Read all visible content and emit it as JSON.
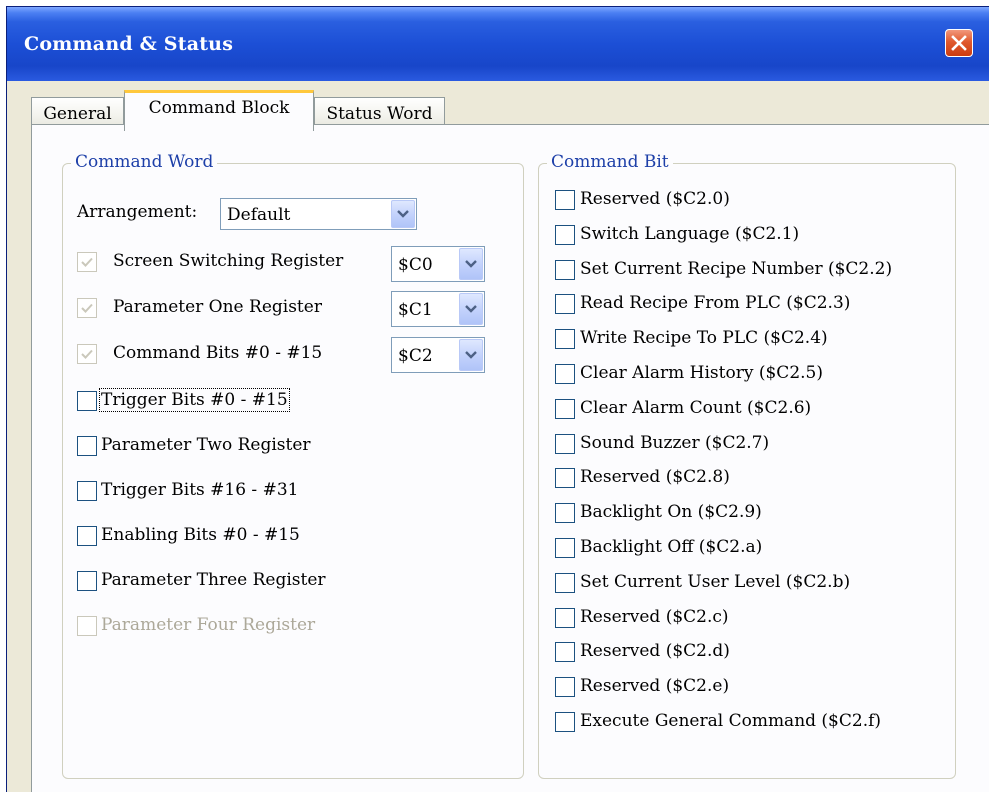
{
  "window": {
    "title": "Command & Status"
  },
  "tabs": [
    {
      "label": "General",
      "active": false
    },
    {
      "label": "Command Block",
      "active": true
    },
    {
      "label": "Status Word",
      "active": false
    }
  ],
  "command_word": {
    "legend": "Command Word",
    "arrangement_label": "Arrangement:",
    "arrangement_value": "Default",
    "registers": [
      {
        "label": "Screen Switching Register",
        "checked": true,
        "disabled": true,
        "address": "$C0"
      },
      {
        "label": "Parameter One Register",
        "checked": true,
        "disabled": true,
        "address": "$C1"
      },
      {
        "label": "Command Bits #0 - #15",
        "checked": true,
        "disabled": true,
        "address": "$C2"
      }
    ],
    "options": [
      {
        "label": "Trigger Bits #0 - #15",
        "checked": false,
        "disabled": false,
        "focused": true
      },
      {
        "label": "Parameter Two Register",
        "checked": false,
        "disabled": false
      },
      {
        "label": "Trigger Bits #16 - #31",
        "checked": false,
        "disabled": false
      },
      {
        "label": "Enabling Bits #0 - #15",
        "checked": false,
        "disabled": false
      },
      {
        "label": "Parameter Three Register",
        "checked": false,
        "disabled": false
      },
      {
        "label": "Parameter Four Register",
        "checked": false,
        "disabled": true
      }
    ]
  },
  "command_bit": {
    "legend": "Command Bit",
    "items": [
      {
        "label": "Reserved ($C2.0)",
        "checked": false
      },
      {
        "label": "Switch Language ($C2.1)",
        "checked": false
      },
      {
        "label": "Set Current Recipe Number ($C2.2)",
        "checked": false
      },
      {
        "label": "Read Recipe From PLC ($C2.3)",
        "checked": false
      },
      {
        "label": "Write Recipe To PLC ($C2.4)",
        "checked": false
      },
      {
        "label": "Clear Alarm History ($C2.5)",
        "checked": false
      },
      {
        "label": "Clear Alarm Count ($C2.6)",
        "checked": false
      },
      {
        "label": "Sound Buzzer ($C2.7)",
        "checked": false
      },
      {
        "label": "Reserved ($C2.8)",
        "checked": false
      },
      {
        "label": "Backlight On ($C2.9)",
        "checked": false
      },
      {
        "label": "Backlight Off ($C2.a)",
        "checked": false
      },
      {
        "label": "Set Current User Level ($C2.b)",
        "checked": false
      },
      {
        "label": "Reserved ($C2.c)",
        "checked": false
      },
      {
        "label": "Reserved ($C2.d)",
        "checked": false
      },
      {
        "label": "Reserved ($C2.e)",
        "checked": false
      },
      {
        "label": "Execute General Command ($C2.f)",
        "checked": false
      }
    ]
  },
  "colors": {
    "titlebar": "#1c4fd6",
    "close_button": "#e05a2e",
    "group_legend": "#1d3fa8",
    "active_tab_highlight": "#ffc83c",
    "disabled_text": "#aca899"
  }
}
